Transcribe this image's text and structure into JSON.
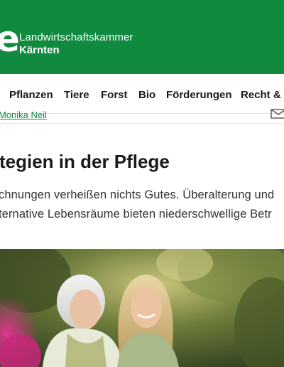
{
  "header": {
    "logo_glyph": "e",
    "brand_line1": "Landwirtschaftskammer",
    "brand_line2": "Kärnten",
    "background": "#0f8a3e"
  },
  "nav": {
    "items": [
      {
        "label": "Pflanzen"
      },
      {
        "label": "Tiere"
      },
      {
        "label": "Forst"
      },
      {
        "label": "Bio"
      },
      {
        "label": "Förderungen"
      },
      {
        "label": "Recht & S"
      }
    ]
  },
  "article": {
    "author": "Monika Neil",
    "title": "tegien in der Pflege",
    "lead_line1": "chnungen verheißen nichts Gutes. Überalterung und",
    "lead_line2": "ternative Lebensräume bieten niederschwellige Betr"
  },
  "icons": {
    "mail": "envelope-icon"
  },
  "hero_image": {
    "alt_subject": "elderly-woman-and-younger-woman-smiling-outdoors"
  }
}
